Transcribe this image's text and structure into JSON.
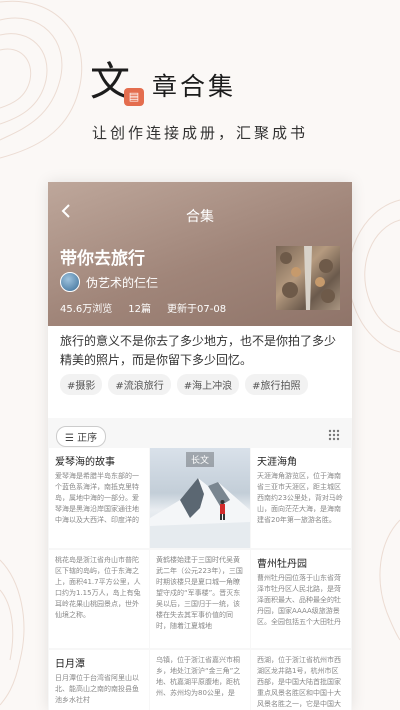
{
  "hero": {
    "big_char": "文",
    "badge": "▤",
    "title_rest": "章合集",
    "subtitle": "让创作连接成册，汇聚成书"
  },
  "card": {
    "header_title": "合集",
    "album_title": "带你去旅行",
    "author": "伪艺术的仨仨",
    "views": "45.6万浏览",
    "count": "12篇",
    "updated": "更新于07-08",
    "description": "旅行的意义不是你去了多少地方，也不是你拍了多少精美的照片，而是你留下多少回忆。",
    "tags": [
      "#摄影",
      "#流浪旅行",
      "#海上冲浪",
      "#旅行拍照"
    ],
    "sort_label": "☰ 正序"
  },
  "list": {
    "col1": [
      {
        "title": "爱琴海的故事",
        "text": "爱琴海是希腊半岛东部的一个蓝色系海洋，南抵克里特岛，属地中海的一部分。爱琴海是黑海沿岸国家通往地中海以及大西洋、印度洋的"
      },
      {
        "title": "",
        "text": "桃花岛是浙江省舟山市普陀区下辖的岛屿，位于东海之上，面积41.7平方公里，人口约为1.15万人，岛上有兔耳岭花果山桃园景点，世外仙境之称。"
      },
      {
        "title": "日月潭",
        "text": "日月潭位于台湾省阿里山以北、能高山之南的南投县鱼池乡水社村"
      }
    ],
    "col2": [
      {
        "photo_label": "长文"
      },
      {
        "title": "",
        "text": "黄鹤楼始建于三国时代吴黄武二年（公元223年），三国时期该楼只是夏口城一角瞭望守戍的“军事楼”。晋灭东吴以后，三国归于一统，该楼在失去其军事价值的同时，随着江夏城地"
      },
      {
        "title": "",
        "text": "乌镇，位于浙江省嘉兴市桐乡，地处江浙沪“金三角”之地、杭嘉湖平原腹地，距杭州、苏州均为80公里，是"
      }
    ],
    "col3": [
      {
        "title": "天涯海角",
        "text": "天涯海角游览区，位于海南省三亚市天涯区，距主城区西南约23公里处，背对马岭山，面向茫茫大海，是海南建省20年第一旅游名胜。"
      },
      {
        "title": "曹州牡丹园",
        "text": "曹州牡丹园位落于山东省菏泽市牡丹区人民北路，是菏泽面积最大、品种最全的牡丹园，国家AAAA级旅游景区。全园包括五个大田牡丹"
      },
      {
        "title": "",
        "text": "西湖，位于浙江省杭州市西湖区龙井路1号，杭州市区西部，是中国大陆首批国家重点风景名胜区和中国十大风景名胜之一，它是中国大陆主要"
      }
    ]
  }
}
